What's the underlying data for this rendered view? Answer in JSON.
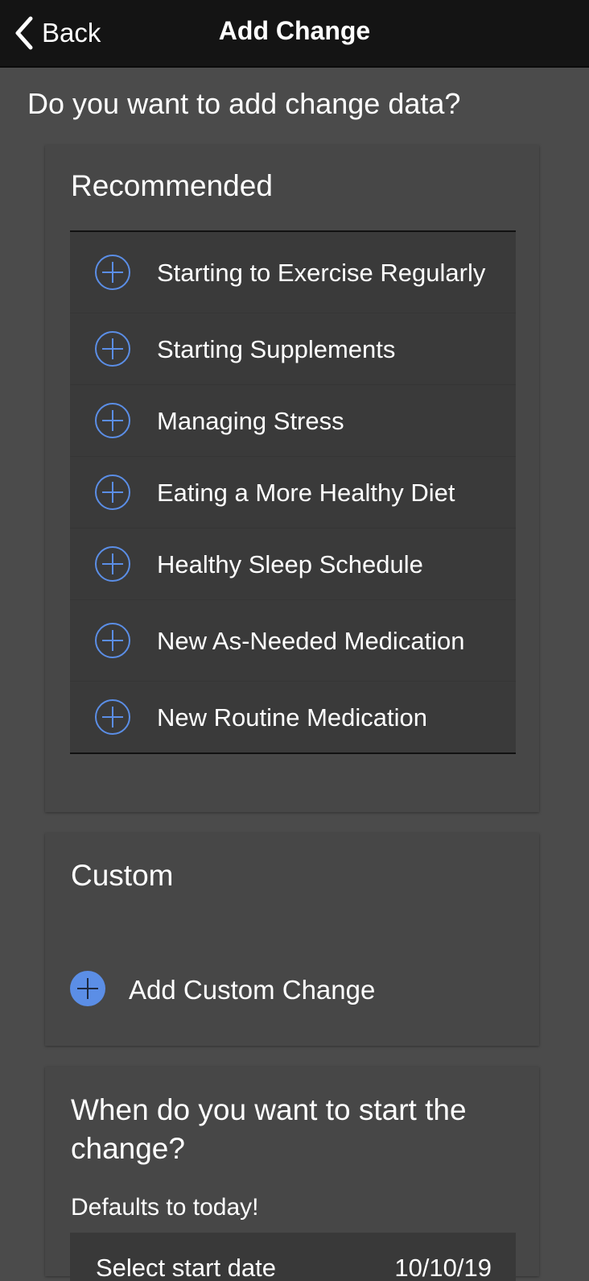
{
  "nav": {
    "back_label": "Back",
    "title": "Add Change"
  },
  "page": {
    "question": "Do you want to add change data?"
  },
  "recommended": {
    "title": "Recommended",
    "items": [
      {
        "label": "Starting to Exercise Regularly",
        "icon": "plus-circle-outline-icon"
      },
      {
        "label": "Starting Supplements",
        "icon": "plus-circle-outline-icon"
      },
      {
        "label": "Managing Stress",
        "icon": "plus-circle-outline-icon"
      },
      {
        "label": "Eating a More Healthy Diet",
        "icon": "plus-circle-outline-icon"
      },
      {
        "label": "Healthy Sleep Schedule",
        "icon": "plus-circle-outline-icon"
      },
      {
        "label": "New As-Needed Medication",
        "icon": "plus-circle-outline-icon"
      },
      {
        "label": "New Routine Medication",
        "icon": "plus-circle-outline-icon"
      }
    ]
  },
  "custom": {
    "title": "Custom",
    "add_label": "Add Custom Change",
    "icon": "plus-circle-filled-icon"
  },
  "start": {
    "title": "When do you want to start the change?",
    "subtitle": "Defaults to today!",
    "date_label": "Select start date",
    "date_value": "10/10/19"
  },
  "colors": {
    "background": "#4b4b4b",
    "card": "#474747",
    "list": "#3a3a3a",
    "nav_bar": "#141414",
    "accent": "#5b8ee6"
  }
}
